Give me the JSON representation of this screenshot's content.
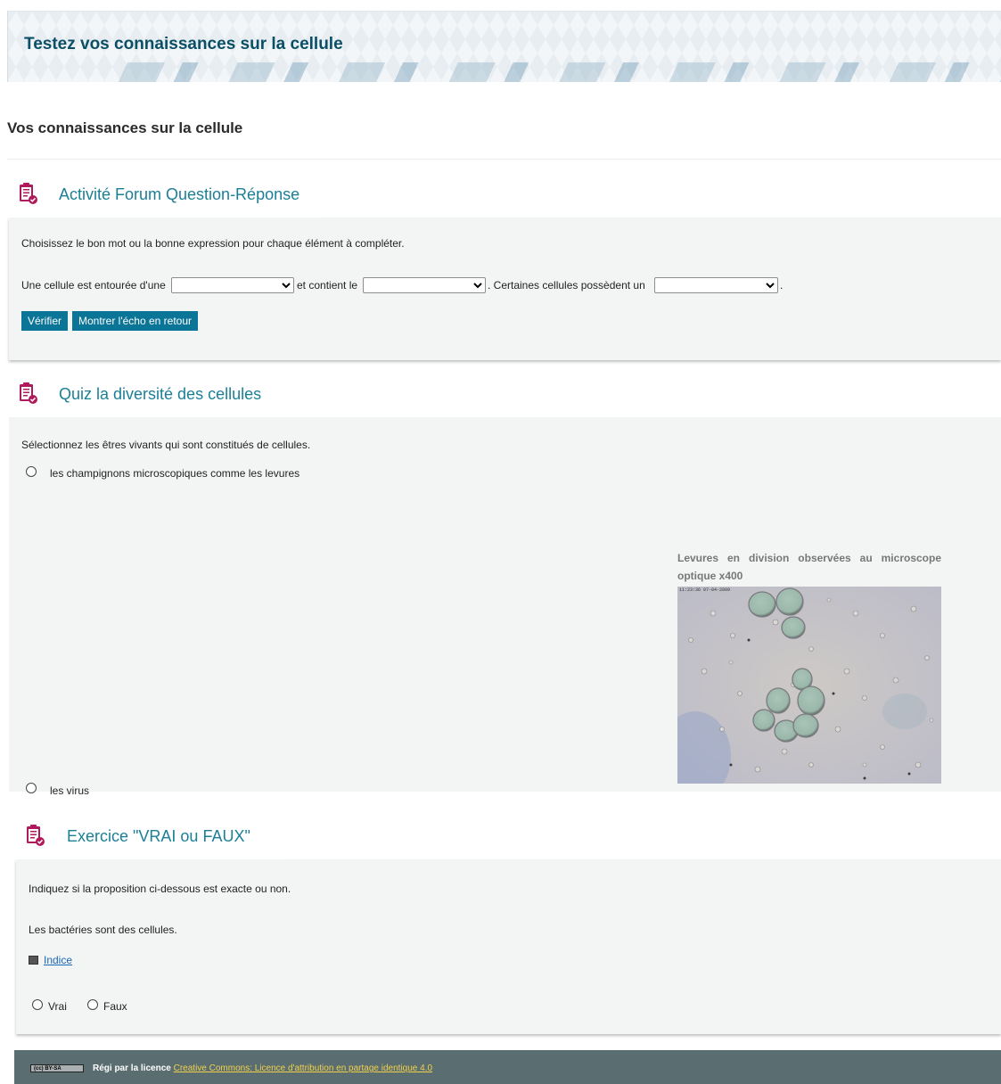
{
  "header": {
    "title": "Testez vos connaissances sur la cellule"
  },
  "page_title": "Vos connaissances sur la cellule",
  "activity1": {
    "title": "Activité Forum Question-Réponse",
    "instruction": "Choisissez le bon mot ou la bonne expression pour chaque élément à compléter.",
    "sentence": {
      "part1": "Une cellule est entourée d'une",
      "part2": "et contient le",
      "part3": ". Certaines cellules possèdent un",
      "part4": "."
    },
    "select1_value": "",
    "select2_value": "",
    "select3_value": "",
    "check_label": "Vérifier",
    "feedback_label": "Montrer l'écho en retour"
  },
  "activity2": {
    "title": "Quiz la diversité des cellules",
    "instruction": "Sélectionnez les êtres vivants qui sont constitués de cellules.",
    "option1": "les champignons microscopiques comme les levures",
    "figure_caption": "Levures en division observées au microscope optique x400",
    "figure_stamp": "11:23:36 07-04-2009",
    "option2": "les virus"
  },
  "activity3": {
    "title": "Exercice \"VRAI ou FAUX\"",
    "instruction": "Indiquez si la proposition ci-dessous est exacte ou non.",
    "statement": "Les bactéries sont des cellules.",
    "hint_label": "Indice",
    "true_label": "Vrai",
    "false_label": "Faux"
  },
  "footer": {
    "badge": "(cc) BY-SA",
    "prefix": "Régi par la licence",
    "license_link": "Creative Commons: Licence d'attribution en partage identique 4.0"
  },
  "colors": {
    "accent": "#0a7596",
    "title_teal": "#1b7f96",
    "icon_magenta": "#b01a5c",
    "footer_bg": "#5a6e72"
  },
  "icons": [
    "clipboard-check-icon",
    "hint-image-icon",
    "cc-license-icon"
  ]
}
